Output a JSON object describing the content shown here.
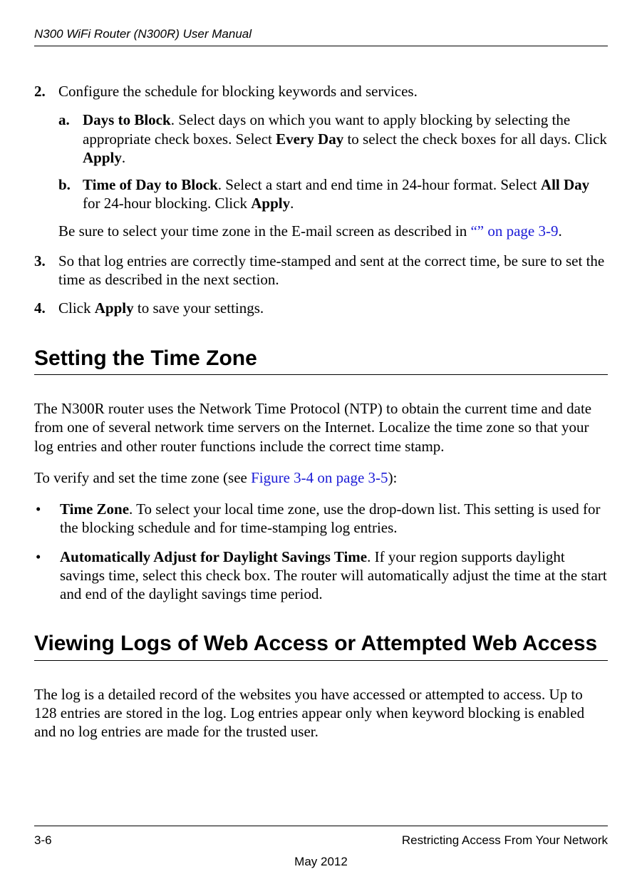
{
  "header": {
    "running_head": "N300 WiFi Router (N300R) User Manual"
  },
  "step2": {
    "num": "2.",
    "text": "Configure the schedule for blocking keywords and services.",
    "a": {
      "num": "a.",
      "lead": "Days to Block",
      "rest1": ". Select days on which you want to apply blocking by selecting the appropriate check boxes. Select ",
      "everyday": "Every Day",
      "rest2": " to select the check boxes for all days. Click ",
      "apply": "Apply",
      "rest3": "."
    },
    "b": {
      "num": "b.",
      "lead": "Time of Day to Block",
      "rest1": ". Select a start and end time in 24-hour format. Select ",
      "allday": "All Day",
      "rest2": " for 24-hour blocking. Click ",
      "apply": "Apply",
      "rest3": "."
    },
    "note_pre": "Be sure to select your time zone in the E-mail screen as described in ",
    "note_link": "“” on page 3-9",
    "note_post": "."
  },
  "step3": {
    "num": "3.",
    "text": "So that log entries are correctly time-stamped and sent at the correct time, be sure to set the time as described in the next section."
  },
  "step4": {
    "num": "4.",
    "pre": "Click ",
    "apply": "Apply",
    "post": " to save your settings."
  },
  "section_tz": {
    "title": "Setting the Time Zone",
    "para1": "The N300R router uses the Network Time Protocol (NTP) to obtain the current time and date from one of several network time servers on the Internet. Localize the time zone so that your log entries and other router functions include the correct time stamp.",
    "para2_pre": "To verify and set the time zone (see ",
    "para2_link": "Figure 3-4 on page 3-5",
    "para2_post": "):",
    "bullet1_lead": "Time Zone",
    "bullet1_rest": ". To select your local time zone, use the drop-down list. This setting is used for the blocking schedule and for time-stamping log entries.",
    "bullet2_lead": "Automatically Adjust for Daylight Savings Time",
    "bullet2_rest": ". If your region supports daylight savings time, select this check box. The router will automatically adjust the time at the start and end of the daylight savings time period."
  },
  "section_logs": {
    "title": "Viewing Logs of Web Access or Attempted Web Access",
    "para": "The log is a detailed record of the websites you have accessed or attempted to access. Up to 128 entries are stored in the log. Log entries appear only when keyword blocking is enabled and no log entries are made for the trusted user."
  },
  "footer": {
    "left": "3-6",
    "right": "Restricting Access From Your Network",
    "center": "May 2012"
  }
}
